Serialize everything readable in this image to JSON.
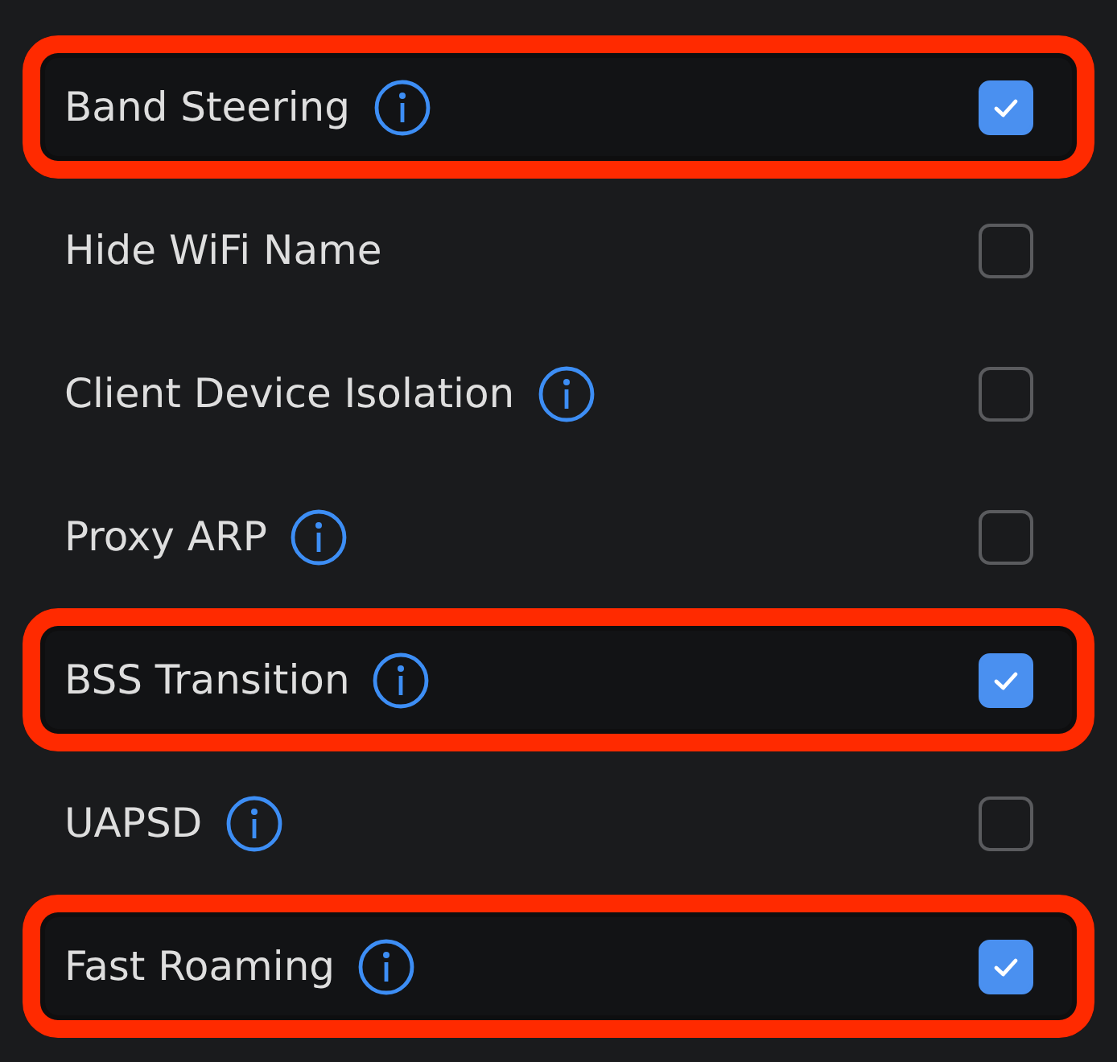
{
  "settings": [
    {
      "label": "Band Steering",
      "info": true,
      "checked": true,
      "highlighted": true
    },
    {
      "label": "Hide WiFi Name",
      "info": false,
      "checked": false,
      "highlighted": false
    },
    {
      "label": "Client Device Isolation",
      "info": true,
      "checked": false,
      "highlighted": false
    },
    {
      "label": "Proxy ARP",
      "info": true,
      "checked": false,
      "highlighted": false
    },
    {
      "label": "BSS Transition",
      "info": true,
      "checked": true,
      "highlighted": true
    },
    {
      "label": "UAPSD",
      "info": true,
      "checked": false,
      "highlighted": false
    },
    {
      "label": "Fast Roaming",
      "info": true,
      "checked": true,
      "highlighted": true
    }
  ]
}
